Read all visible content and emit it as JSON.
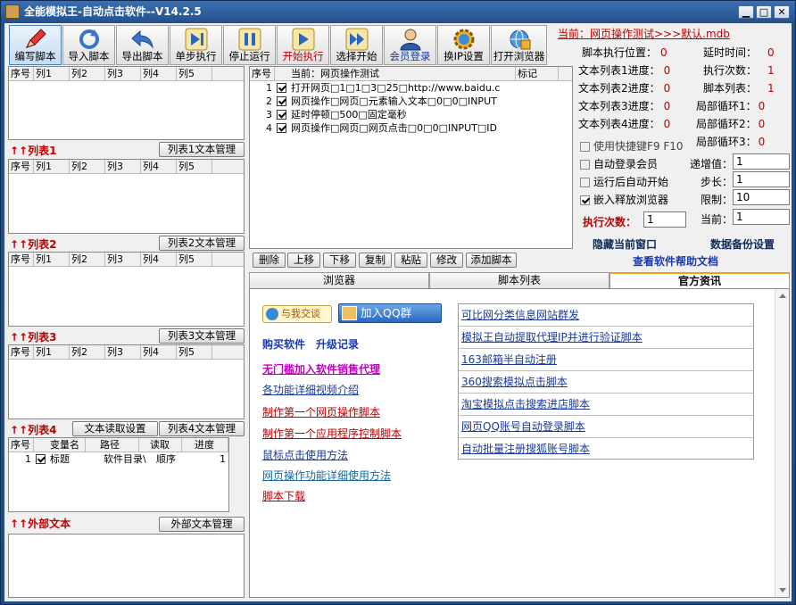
{
  "window": {
    "title": "全能模拟王-自动点击软件--V14.2.5",
    "min": "▁",
    "max": "□",
    "close": "✕"
  },
  "toolbar": [
    {
      "label": "编写脚本",
      "icon": "pencil-icon"
    },
    {
      "label": "导入脚本",
      "icon": "refresh-icon"
    },
    {
      "label": "导出脚本",
      "icon": "undo-arrow-icon"
    },
    {
      "label": "单步执行",
      "icon": "step-forward-icon"
    },
    {
      "label": "停止运行",
      "icon": "pause-icon"
    },
    {
      "label": "开始执行",
      "icon": "play-icon"
    },
    {
      "label": "选择开始",
      "icon": "fast-forward-icon"
    },
    {
      "label": "会员登录",
      "icon": "user-icon"
    },
    {
      "label": "换IP设置",
      "icon": "gear-globe-icon"
    },
    {
      "label": "打开浏览器",
      "icon": "globe-icon"
    }
  ],
  "current_file": "当前：网页操作测试>>>默认.mdb",
  "grid_headers": [
    "序号",
    "列1",
    "列2",
    "列3",
    "列4",
    "列5"
  ],
  "lists": {
    "list1": {
      "title": "↑↑列表1",
      "btn": "列表1文本管理"
    },
    "list2": {
      "title": "↑↑列表2",
      "btn": "列表2文本管理"
    },
    "list3": {
      "title": "↑↑列表3",
      "btn": "列表3文本管理"
    },
    "list4": {
      "title": "↑↑列表4",
      "btn": "列表4文本管理",
      "btn2": "文本读取设置",
      "headers": [
        "序号",
        "变量名",
        "路径",
        "读取",
        "进度"
      ],
      "row": {
        "num": "1",
        "name": "标题",
        "path": "软件目录\\",
        "read": "顺序",
        "progress": "1"
      }
    },
    "external": {
      "title": "↑↑外部文本",
      "btn": "外部文本管理"
    }
  },
  "script": {
    "headers": {
      "num": "序号",
      "current": "当前：网页操作测试",
      "mark": "标记"
    },
    "rows": [
      {
        "num": "1",
        "text": "打开网页□1□1□3□25□http://www.baidu.c"
      },
      {
        "num": "2",
        "text": "网页操作□网页□元素输入文本□0□0□INPUT"
      },
      {
        "num": "3",
        "text": "延时停顿□500□固定毫秒"
      },
      {
        "num": "4",
        "text": "网页操作□网页□网页点击□0□0□INPUT□ID"
      }
    ]
  },
  "status": {
    "exec_pos": {
      "label": "脚本执行位置：",
      "value": "0"
    },
    "delay": {
      "label": "延时时间：",
      "value": "0"
    },
    "t1": {
      "label": "文本列表1进度：",
      "value": "0"
    },
    "exec_count": {
      "label": "执行次数：",
      "value": "1"
    },
    "t2": {
      "label": "文本列表2进度：",
      "value": "0"
    },
    "script_list": {
      "label": "脚本列表：",
      "value": "1"
    },
    "t3": {
      "label": "文本列表3进度：",
      "value": "0"
    },
    "loop1": {
      "label": "局部循环1：",
      "value": "0"
    },
    "t4": {
      "label": "文本列表4进度：",
      "value": "0"
    },
    "loop2": {
      "label": "局部循环2：",
      "value": "0"
    },
    "loop3": {
      "label": "局部循环3：",
      "value": "0"
    }
  },
  "options": {
    "hotkey": "使用快捷键F9 F10",
    "autologin": "自动登录会员",
    "autostart": "运行后自动开始",
    "embed": "嵌入释放浏览器",
    "increment_label": "递增值：",
    "increment": "1",
    "step_label": "步长：",
    "step": "1",
    "limit_label": "限制：",
    "limit": "10",
    "exec_times_label": "执行次数：",
    "exec_times": "1",
    "current_label": "当前：",
    "current": "1",
    "hide_window": "隐藏当前窗口",
    "backup": "数据备份设置",
    "help": "查看软件帮助文档"
  },
  "actions": [
    "删除",
    "上移",
    "下移",
    "复制",
    "粘贴",
    "修改",
    "添加脚本"
  ],
  "tabs": [
    "浏览器",
    "脚本列表",
    "官方资讯"
  ],
  "news": {
    "chat_btn": "与我交谈",
    "qq_btn": "加入QQ群",
    "buy": "购买软件",
    "upgrade": "升级记录",
    "agent": "无门槛加入软件销售代理",
    "video": "各功能详细视频介绍",
    "first_web": "制作第一个网页操作脚本",
    "first_app": "制作第一个应用程序控制脚本",
    "mouse": "鼠标点击使用方法",
    "web_ops": "网页操作功能详细使用方法",
    "download": "脚本下载",
    "right": [
      "可比网分类信息网站群发",
      "模拟王自动提取代理IP并进行验证脚本",
      "163邮箱半自动注册",
      "360搜索模拟点击脚本",
      "淘宝模拟点击搜索进店脚本",
      "网页QQ账号自动登录脚本",
      "自动批量注册搜狐账号脚本"
    ]
  },
  "colors": {
    "accent_red": "#c00000",
    "link_blue": "#1a3a9a",
    "title_bar": "#22508c"
  }
}
